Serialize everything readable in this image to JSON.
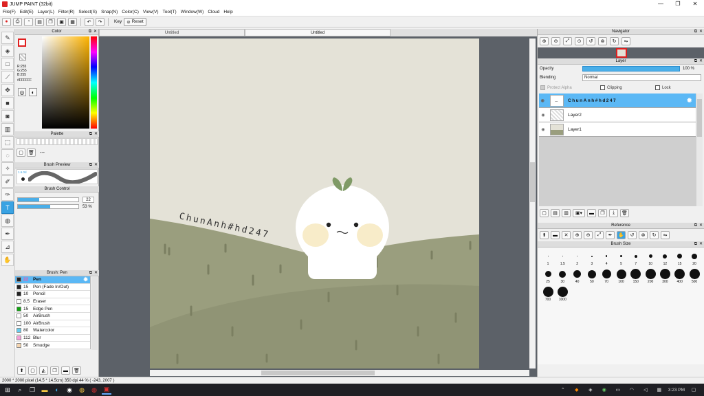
{
  "window": {
    "title": "JUMP PAINT (32bit)",
    "min": "—",
    "max": "❐",
    "close": "✕"
  },
  "menu": [
    "File(F)",
    "Edit(E)",
    "Layer(L)",
    "Filter(R)",
    "Select(S)",
    "Snap(N)",
    "Color(C)",
    "View(V)",
    "Tool(T)",
    "Window(W)",
    "Cloud",
    "Help"
  ],
  "toolbar": {
    "key_label": "Key",
    "reset_label": "Reset"
  },
  "color_panel": {
    "title": "Color",
    "r": "R:255",
    "g": "G:255",
    "b": "B:255",
    "hex": "#FFFFFF"
  },
  "palette_panel": {
    "title": "Palette",
    "dash": "---"
  },
  "brush_preview": {
    "title": "Brush Preview",
    "size": "1.6.0d"
  },
  "brush_control": {
    "title": "Brush Control",
    "size": "22",
    "opacity": "53 %",
    "size_fill": 0.35,
    "opacity_fill": 0.53
  },
  "brush_list": {
    "title": "Brush: Pen",
    "items": [
      {
        "size": "22",
        "name": "Pen",
        "color": "#222222"
      },
      {
        "size": "15",
        "name": "Pen (Fade In/Out)",
        "color": "#222222"
      },
      {
        "size": "10",
        "name": "Pencil",
        "color": "#222222"
      },
      {
        "size": "8.5",
        "name": "Eraser",
        "color": "#ffffff"
      },
      {
        "size": "15",
        "name": "Edge Pen",
        "color": "#12a012"
      },
      {
        "size": "50",
        "name": "AirBrush",
        "color": "#ffffff"
      },
      {
        "size": "100",
        "name": "AirBrush",
        "color": "#ffffff"
      },
      {
        "size": "80",
        "name": "Watercolor",
        "color": "#66ccee"
      },
      {
        "size": "112",
        "name": "Blur",
        "color": "#f4a0d8"
      },
      {
        "size": "50",
        "name": "Smudge",
        "color": "#f5d5b0"
      }
    ]
  },
  "tabs": {
    "first": "Untitled",
    "second": "Untitled"
  },
  "canvas": {
    "watermark": "ChunAnh#hd247"
  },
  "navigator": {
    "title": "Navigator"
  },
  "layer_panel": {
    "title": "Layer",
    "opacity_label": "Opacity",
    "opacity_value": "100 %",
    "blending_label": "Blending",
    "blending_value": "Normal",
    "protect_alpha": "Protect Alpha",
    "clipping": "Clipping",
    "lock": "Lock",
    "layers": [
      {
        "name": "ChunAnh#hd247"
      },
      {
        "name": "Layer2"
      },
      {
        "name": "Layer1"
      }
    ]
  },
  "reference": {
    "title": "Reference"
  },
  "brush_size": {
    "title": "Brush Size",
    "sizes": [
      "1",
      "1.5",
      "2",
      "3",
      "4",
      "5",
      "7",
      "10",
      "12",
      "15",
      "20",
      "25",
      "30",
      "40",
      "50",
      "70",
      "100",
      "150",
      "200",
      "300",
      "400",
      "500",
      "700",
      "1000"
    ]
  },
  "status": {
    "text": "2000 * 2000 pixel   (14.5 * 14.5cm)   350 dpi   44 %   ( -243, 2007 )"
  },
  "taskbar": {
    "time": "3:23 PM"
  },
  "colors": {
    "accent": "#3aa3e3",
    "canvas_bg": "#e4e2d7",
    "hill": "#9a9e7e",
    "hill_dark": "#898d6d",
    "sprout": "#7f9a66"
  }
}
